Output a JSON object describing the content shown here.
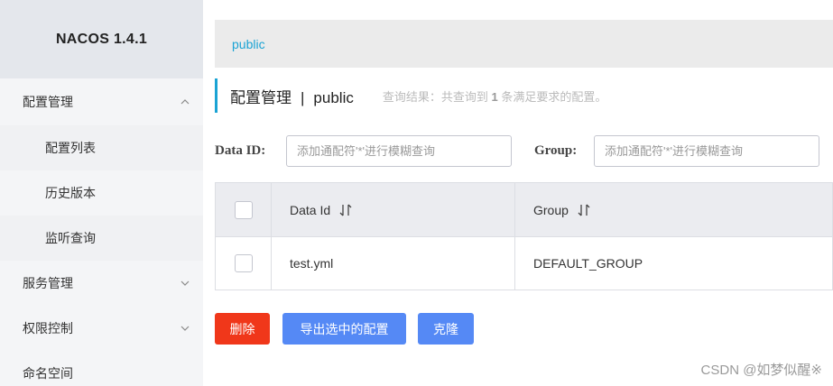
{
  "app": {
    "title": "NACOS 1.4.1"
  },
  "sidebar": {
    "config_management": "配置管理",
    "config_list": "配置列表",
    "history_versions": "历史版本",
    "listener_query": "监听查询",
    "service_management": "服务管理",
    "access_control": "权限控制",
    "namespace": "命名空间"
  },
  "breadcrumb": {
    "namespace": "public"
  },
  "header": {
    "title": "配置管理",
    "separator": "|",
    "namespace": "public",
    "result_prefix": "查询结果：共查询到",
    "result_count": "1",
    "result_suffix": "条满足要求的配置。"
  },
  "filters": {
    "data_id_label": "Data ID:",
    "data_id_placeholder": "添加通配符'*'进行模糊查询",
    "group_label": "Group:",
    "group_placeholder": "添加通配符'*'进行模糊查询"
  },
  "table": {
    "columns": [
      "Data Id",
      "Group"
    ],
    "rows": [
      {
        "data_id": "test.yml",
        "group": "DEFAULT_GROUP"
      }
    ]
  },
  "actions": {
    "delete": "删除",
    "export_selected": "导出选中的配置",
    "clone": "克隆"
  },
  "watermark": "CSDN @如梦似醒※",
  "colors": {
    "accent": "#1aa3d4",
    "danger": "#f0371a",
    "primary": "#5589f5"
  },
  "icons": {
    "expanded": "chevron-up-icon",
    "collapsed": "chevron-down-icon",
    "sort": "sort-icon"
  }
}
